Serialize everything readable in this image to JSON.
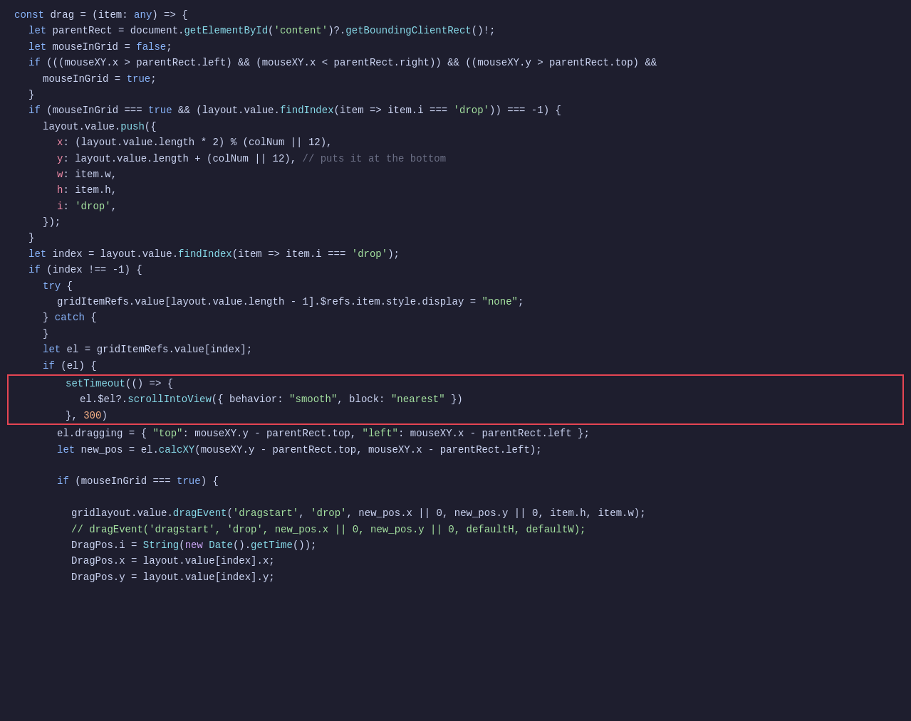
{
  "editor": {
    "background": "#1e1e2e",
    "lines": [
      {
        "id": "l1",
        "indent": 0,
        "tokens": [
          {
            "t": "kw",
            "v": "const "
          },
          {
            "t": "var",
            "v": "drag "
          },
          {
            "t": "plain",
            "v": "= ("
          },
          {
            "t": "var",
            "v": "item"
          },
          {
            "t": "plain",
            "v": ": "
          },
          {
            "t": "blue",
            "v": "any"
          },
          {
            "t": "plain",
            "v": ") => {"
          }
        ]
      },
      {
        "id": "l2",
        "indent": 1,
        "tokens": [
          {
            "t": "kw",
            "v": "let "
          },
          {
            "t": "var",
            "v": "parentRect "
          },
          {
            "t": "plain",
            "v": "= "
          },
          {
            "t": "plain",
            "v": "document."
          },
          {
            "t": "fn",
            "v": "getElementById"
          },
          {
            "t": "plain",
            "v": "("
          },
          {
            "t": "str",
            "v": "'content'"
          },
          {
            "t": "plain",
            "v": ")?."
          },
          {
            "t": "fn",
            "v": "getBoundingClientRect"
          },
          {
            "t": "plain",
            "v": "()!;"
          }
        ]
      },
      {
        "id": "l3",
        "indent": 1,
        "tokens": [
          {
            "t": "kw",
            "v": "let "
          },
          {
            "t": "var",
            "v": "mouseInGrid "
          },
          {
            "t": "plain",
            "v": "= "
          },
          {
            "t": "blue",
            "v": "false"
          },
          {
            "t": "plain",
            "v": ";"
          }
        ]
      },
      {
        "id": "l4",
        "indent": 1,
        "tokens": [
          {
            "t": "kw",
            "v": "if "
          },
          {
            "t": "plain",
            "v": "((("
          },
          {
            "t": "var",
            "v": "mouseXY"
          },
          {
            "t": "plain",
            "v": ".x > "
          },
          {
            "t": "var",
            "v": "parentRect"
          },
          {
            "t": "plain",
            "v": ".left) && ("
          },
          {
            "t": "var",
            "v": "mouseXY"
          },
          {
            "t": "plain",
            "v": ".x < "
          },
          {
            "t": "var",
            "v": "parentRect"
          },
          {
            "t": "plain",
            "v": ".right)) && (("
          },
          {
            "t": "var",
            "v": "mouseXY"
          },
          {
            "t": "plain",
            "v": ".y > "
          },
          {
            "t": "var",
            "v": "parentRect"
          },
          {
            "t": "plain",
            "v": ".top) &&"
          }
        ]
      },
      {
        "id": "l5",
        "indent": 2,
        "tokens": [
          {
            "t": "var",
            "v": "mouseInGrid "
          },
          {
            "t": "plain",
            "v": "= "
          },
          {
            "t": "blue",
            "v": "true"
          },
          {
            "t": "plain",
            "v": ";"
          }
        ]
      },
      {
        "id": "l6",
        "indent": 1,
        "tokens": [
          {
            "t": "plain",
            "v": "}"
          }
        ]
      },
      {
        "id": "l7",
        "indent": 1,
        "tokens": [
          {
            "t": "kw",
            "v": "if "
          },
          {
            "t": "plain",
            "v": "("
          },
          {
            "t": "var",
            "v": "mouseInGrid "
          },
          {
            "t": "plain",
            "v": "=== "
          },
          {
            "t": "blue",
            "v": "true "
          },
          {
            "t": "plain",
            "v": "&& ("
          },
          {
            "t": "var",
            "v": "layout"
          },
          {
            "t": "plain",
            "v": ".value."
          },
          {
            "t": "fn",
            "v": "findIndex"
          },
          {
            "t": "plain",
            "v": "("
          },
          {
            "t": "var",
            "v": "item "
          },
          {
            "t": "plain",
            "v": "=> "
          },
          {
            "t": "var",
            "v": "item"
          },
          {
            "t": "plain",
            "v": ".i === "
          },
          {
            "t": "str",
            "v": "'drop'"
          },
          {
            "t": "plain",
            "v": ")) === -1) {"
          }
        ]
      },
      {
        "id": "l8",
        "indent": 2,
        "tokens": [
          {
            "t": "var",
            "v": "layout"
          },
          {
            "t": "plain",
            "v": ".value."
          },
          {
            "t": "fn",
            "v": "push"
          },
          {
            "t": "plain",
            "v": "({"
          }
        ]
      },
      {
        "id": "l9",
        "indent": 3,
        "tokens": [
          {
            "t": "var2",
            "v": "x"
          },
          {
            "t": "plain",
            "v": ": ("
          },
          {
            "t": "var",
            "v": "layout"
          },
          {
            "t": "plain",
            "v": ".value.length * 2) % ("
          },
          {
            "t": "var",
            "v": "colNum "
          },
          {
            "t": "plain",
            "v": "|| 12),"
          }
        ]
      },
      {
        "id": "l10",
        "indent": 3,
        "tokens": [
          {
            "t": "var2",
            "v": "y"
          },
          {
            "t": "plain",
            "v": ": "
          },
          {
            "t": "var",
            "v": "layout"
          },
          {
            "t": "plain",
            "v": ".value.length + ("
          },
          {
            "t": "var",
            "v": "colNum "
          },
          {
            "t": "plain",
            "v": "|| 12), "
          },
          {
            "t": "comment",
            "v": "// puts it at the bottom"
          }
        ]
      },
      {
        "id": "l11",
        "indent": 3,
        "tokens": [
          {
            "t": "var2",
            "v": "w"
          },
          {
            "t": "plain",
            "v": ": "
          },
          {
            "t": "var",
            "v": "item"
          },
          {
            "t": "plain",
            "v": ".w,"
          }
        ]
      },
      {
        "id": "l12",
        "indent": 3,
        "tokens": [
          {
            "t": "var2",
            "v": "h"
          },
          {
            "t": "plain",
            "v": ": "
          },
          {
            "t": "var",
            "v": "item"
          },
          {
            "t": "plain",
            "v": ".h,"
          }
        ]
      },
      {
        "id": "l13",
        "indent": 3,
        "tokens": [
          {
            "t": "var2",
            "v": "i"
          },
          {
            "t": "plain",
            "v": ": "
          },
          {
            "t": "str",
            "v": "'drop'"
          },
          {
            "t": "plain",
            "v": ","
          }
        ]
      },
      {
        "id": "l14",
        "indent": 2,
        "tokens": [
          {
            "t": "plain",
            "v": "});"
          }
        ]
      },
      {
        "id": "l15",
        "indent": 1,
        "tokens": [
          {
            "t": "plain",
            "v": "}"
          }
        ]
      },
      {
        "id": "l16",
        "indent": 1,
        "tokens": [
          {
            "t": "kw",
            "v": "let "
          },
          {
            "t": "var",
            "v": "index "
          },
          {
            "t": "plain",
            "v": "= "
          },
          {
            "t": "var",
            "v": "layout"
          },
          {
            "t": "plain",
            "v": ".value."
          },
          {
            "t": "fn",
            "v": "findIndex"
          },
          {
            "t": "plain",
            "v": "("
          },
          {
            "t": "var",
            "v": "item "
          },
          {
            "t": "plain",
            "v": "=> "
          },
          {
            "t": "var",
            "v": "item"
          },
          {
            "t": "plain",
            "v": ".i === "
          },
          {
            "t": "str",
            "v": "'drop'"
          },
          {
            "t": "plain",
            "v": ");"
          }
        ]
      },
      {
        "id": "l17",
        "indent": 1,
        "tokens": [
          {
            "t": "kw",
            "v": "if "
          },
          {
            "t": "plain",
            "v": "("
          },
          {
            "t": "var",
            "v": "index "
          },
          {
            "t": "plain",
            "v": "!== -1) {"
          }
        ]
      },
      {
        "id": "l18",
        "indent": 2,
        "tokens": [
          {
            "t": "kw",
            "v": "try "
          },
          {
            "t": "plain",
            "v": "{"
          }
        ]
      },
      {
        "id": "l19",
        "indent": 3,
        "tokens": [
          {
            "t": "var",
            "v": "gridItemRefs"
          },
          {
            "t": "plain",
            "v": ".value["
          },
          {
            "t": "var",
            "v": "layout"
          },
          {
            "t": "plain",
            "v": ".value.length - 1].$refs.item.style.display = "
          },
          {
            "t": "str",
            "v": "\"none\""
          },
          {
            "t": "plain",
            "v": ";"
          }
        ]
      },
      {
        "id": "l20",
        "indent": 2,
        "tokens": [
          {
            "t": "plain",
            "v": "} "
          },
          {
            "t": "kw",
            "v": "catch "
          },
          {
            "t": "plain",
            "v": "{"
          }
        ]
      },
      {
        "id": "l21",
        "indent": 2,
        "tokens": [
          {
            "t": "plain",
            "v": "}"
          }
        ]
      },
      {
        "id": "l22",
        "indent": 2,
        "tokens": [
          {
            "t": "kw",
            "v": "let "
          },
          {
            "t": "var",
            "v": "el "
          },
          {
            "t": "plain",
            "v": "= "
          },
          {
            "t": "var",
            "v": "gridItemRefs"
          },
          {
            "t": "plain",
            "v": ".value["
          },
          {
            "t": "var",
            "v": "index"
          },
          {
            "t": "plain",
            "v": "];"
          }
        ]
      },
      {
        "id": "l23",
        "indent": 2,
        "tokens": [
          {
            "t": "kw",
            "v": "if "
          },
          {
            "t": "plain",
            "v": "("
          },
          {
            "t": "var",
            "v": "el"
          },
          {
            "t": "plain",
            "v": ") {"
          }
        ]
      },
      {
        "id": "l24",
        "indent": 3,
        "tokens": [
          {
            "t": "fn",
            "v": "setTimeout"
          },
          {
            "t": "plain",
            "v": "(() => {"
          }
        ]
      },
      {
        "id": "l25",
        "indent": 4,
        "tokens": [
          {
            "t": "var",
            "v": "el"
          },
          {
            "t": "plain",
            "v": ".$el?."
          },
          {
            "t": "fn",
            "v": "scrollIntoView"
          },
          {
            "t": "plain",
            "v": "({ behavior: "
          },
          {
            "t": "str",
            "v": "\"smooth\""
          },
          {
            "t": "plain",
            "v": ", block: "
          },
          {
            "t": "str",
            "v": "\"nearest\""
          },
          {
            "t": "plain",
            "v": " })"
          }
        ]
      },
      {
        "id": "l26",
        "indent": 3,
        "tokens": [
          {
            "t": "plain",
            "v": "}, "
          },
          {
            "t": "num",
            "v": "300"
          },
          {
            "t": "plain",
            "v": ")"
          }
        ]
      },
      {
        "id": "l27",
        "indent": 3,
        "tokens": [
          {
            "t": "var",
            "v": "el"
          },
          {
            "t": "plain",
            "v": ".dragging = { "
          },
          {
            "t": "str",
            "v": "\"top\""
          },
          {
            "t": "plain",
            "v": ": "
          },
          {
            "t": "var",
            "v": "mouseXY"
          },
          {
            "t": "plain",
            "v": ".y - "
          },
          {
            "t": "var",
            "v": "parentRect"
          },
          {
            "t": "plain",
            "v": ".top, "
          },
          {
            "t": "str",
            "v": "\"left\""
          },
          {
            "t": "plain",
            "v": ": "
          },
          {
            "t": "var",
            "v": "mouseXY"
          },
          {
            "t": "plain",
            "v": ".x - "
          },
          {
            "t": "var",
            "v": "parentRect"
          },
          {
            "t": "plain",
            "v": ".left };"
          }
        ]
      },
      {
        "id": "l28",
        "indent": 3,
        "tokens": [
          {
            "t": "kw",
            "v": "let "
          },
          {
            "t": "var",
            "v": "new_pos "
          },
          {
            "t": "plain",
            "v": "= "
          },
          {
            "t": "var",
            "v": "el"
          },
          {
            "t": "plain",
            "v": "."
          },
          {
            "t": "fn",
            "v": "calcXY"
          },
          {
            "t": "plain",
            "v": "("
          },
          {
            "t": "var",
            "v": "mouseXY"
          },
          {
            "t": "plain",
            "v": ".y - "
          },
          {
            "t": "var",
            "v": "parentRect"
          },
          {
            "t": "plain",
            "v": ".top, "
          },
          {
            "t": "var",
            "v": "mouseXY"
          },
          {
            "t": "plain",
            "v": ".x - "
          },
          {
            "t": "var",
            "v": "parentRect"
          },
          {
            "t": "plain",
            "v": ".left);"
          }
        ]
      },
      {
        "id": "l29",
        "indent": 0,
        "tokens": []
      },
      {
        "id": "l30",
        "indent": 3,
        "tokens": [
          {
            "t": "kw",
            "v": "if "
          },
          {
            "t": "plain",
            "v": "("
          },
          {
            "t": "var",
            "v": "mouseInGrid "
          },
          {
            "t": "plain",
            "v": "=== "
          },
          {
            "t": "blue",
            "v": "true"
          },
          {
            "t": "plain",
            "v": ") {"
          }
        ]
      },
      {
        "id": "l31",
        "indent": 0,
        "tokens": []
      },
      {
        "id": "l32",
        "indent": 4,
        "tokens": [
          {
            "t": "var",
            "v": "gridlayout"
          },
          {
            "t": "plain",
            "v": ".value."
          },
          {
            "t": "fn",
            "v": "dragEvent"
          },
          {
            "t": "plain",
            "v": "("
          },
          {
            "t": "str",
            "v": "'dragstart'"
          },
          {
            "t": "plain",
            "v": ", "
          },
          {
            "t": "str",
            "v": "'drop'"
          },
          {
            "t": "plain",
            "v": ", "
          },
          {
            "t": "var",
            "v": "new_pos"
          },
          {
            "t": "plain",
            "v": ".x || 0, "
          },
          {
            "t": "var",
            "v": "new_pos"
          },
          {
            "t": "plain",
            "v": ".y || 0, "
          },
          {
            "t": "var",
            "v": "item"
          },
          {
            "t": "plain",
            "v": ".h, "
          },
          {
            "t": "var",
            "v": "item"
          },
          {
            "t": "plain",
            "v": ".w);"
          }
        ]
      },
      {
        "id": "l33",
        "indent": 4,
        "tokens": [
          {
            "t": "comment2",
            "v": "// dragEvent('dragstart', 'drop', new_pos.x || 0, new_pos.y || 0, defaultH, defaultW);"
          }
        ]
      },
      {
        "id": "l34",
        "indent": 4,
        "tokens": [
          {
            "t": "var",
            "v": "DragPos"
          },
          {
            "t": "plain",
            "v": ".i = "
          },
          {
            "t": "fn",
            "v": "String"
          },
          {
            "t": "plain",
            "v": "("
          },
          {
            "t": "kw2",
            "v": "new "
          },
          {
            "t": "fn",
            "v": "Date"
          },
          {
            "t": "plain",
            "v": "()."
          },
          {
            "t": "fn",
            "v": "getTime"
          },
          {
            "t": "plain",
            "v": "());"
          }
        ]
      },
      {
        "id": "l35",
        "indent": 4,
        "tokens": [
          {
            "t": "var",
            "v": "DragPos"
          },
          {
            "t": "plain",
            "v": ".x = "
          },
          {
            "t": "var",
            "v": "layout"
          },
          {
            "t": "plain",
            "v": ".value["
          },
          {
            "t": "var",
            "v": "index"
          },
          {
            "t": "plain",
            "v": "].x;"
          }
        ]
      },
      {
        "id": "l36",
        "indent": 4,
        "tokens": [
          {
            "t": "var",
            "v": "DragPos"
          },
          {
            "t": "plain",
            "v": ".y = "
          },
          {
            "t": "var",
            "v": "layout"
          },
          {
            "t": "plain",
            "v": ".value["
          },
          {
            "t": "var",
            "v": "index"
          },
          {
            "t": "plain",
            "v": "].y;"
          }
        ]
      }
    ],
    "highlight_start": 24,
    "highlight_end": 26
  }
}
